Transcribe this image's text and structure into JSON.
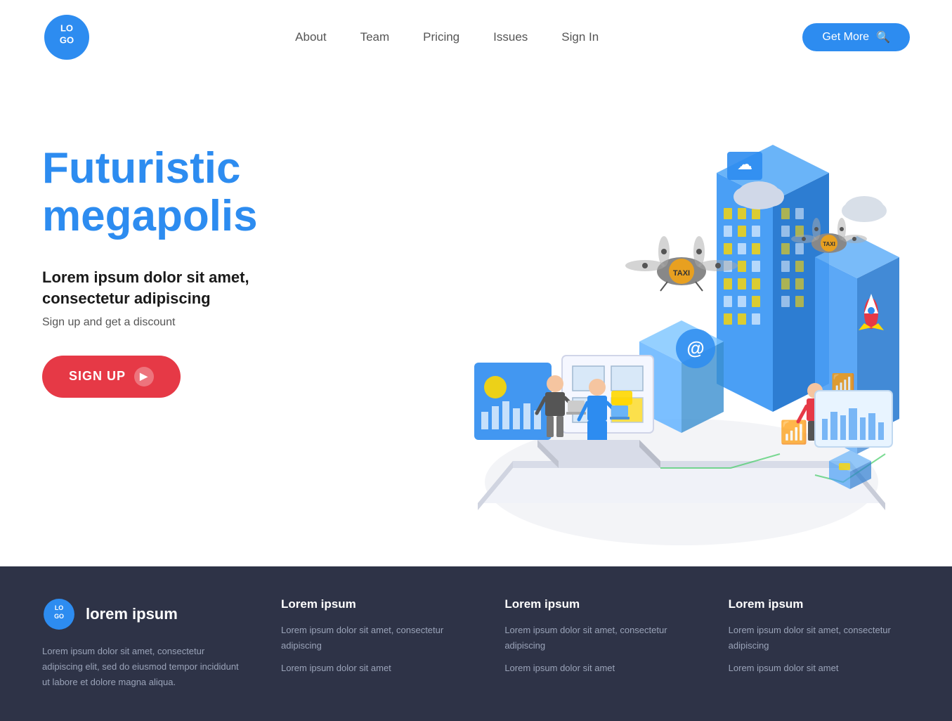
{
  "header": {
    "logo_text": "LOGO",
    "nav": {
      "about": "About",
      "team": "Team",
      "pricing": "Pricing",
      "issues": "Issues",
      "signin": "Sign In"
    },
    "cta": "Get More"
  },
  "hero": {
    "title_line1": "Futuristic",
    "title_line2": "megapolis",
    "subtitle": "Lorem ipsum dolor sit amet, consectetur adipiscing",
    "description": "Sign up and get a discount",
    "cta": "SIGN UP"
  },
  "footer": {
    "brand": {
      "logo": "LOGO",
      "name": "lorem ipsum",
      "description": "Lorem ipsum dolor sit amet, consectetur adipiscing elit, sed do eiusmod tempor incididunt ut labore et dolore magna aliqua."
    },
    "col1": {
      "title": "Lorem ipsum",
      "item1": "Lorem ipsum dolor sit amet, consectetur adipiscing",
      "item2": "Lorem ipsum dolor sit amet"
    },
    "col2": {
      "title": "Lorem ipsum",
      "item1": "Lorem ipsum dolor sit amet, consectetur adipiscing",
      "item2": "Lorem ipsum dolor sit amet"
    },
    "col3": {
      "title": "Lorem ipsum",
      "item1": "Lorem ipsum dolor sit amet, consectetur adipiscing",
      "item2": "Lorem ipsum dolor sit amet"
    }
  }
}
